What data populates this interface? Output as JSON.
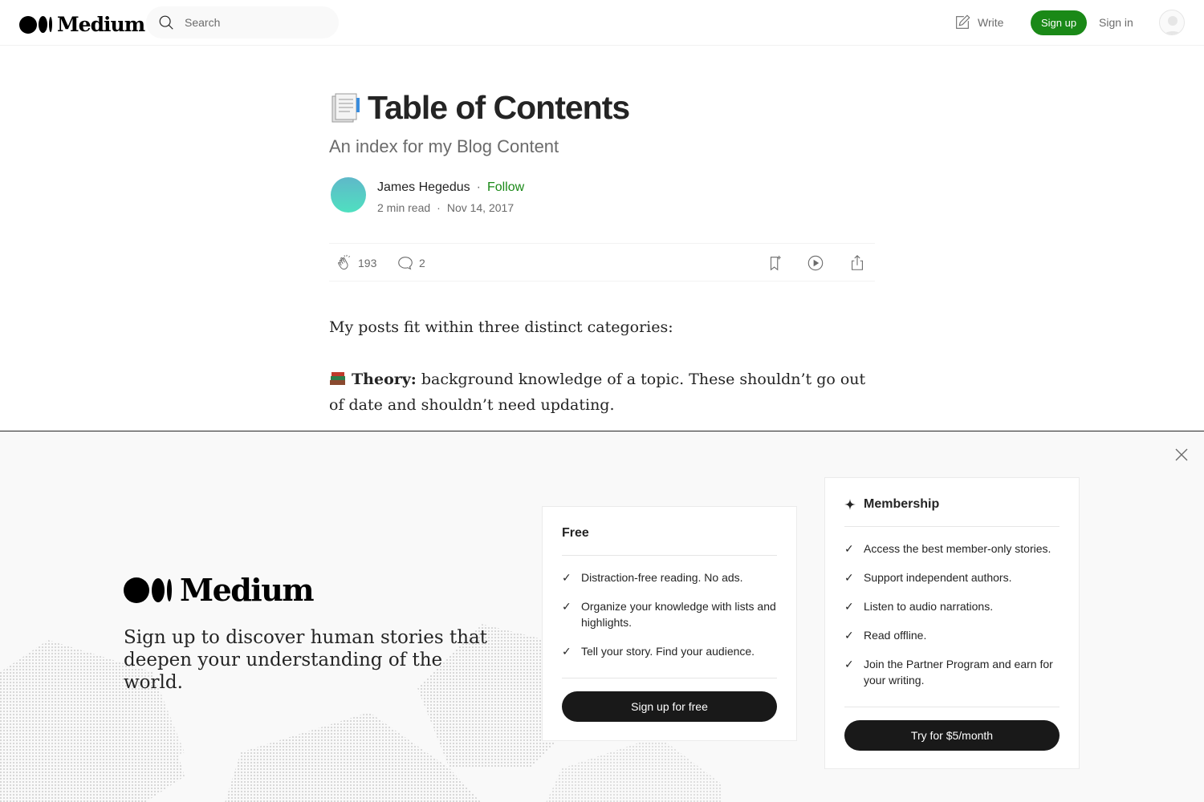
{
  "nav": {
    "logo_text": "Medium",
    "search_placeholder": "Search",
    "write_label": "Write",
    "signup_label": "Sign up",
    "signin_label": "Sign in"
  },
  "article": {
    "title": "Table of Contents",
    "subtitle": "An index for my Blog Content",
    "author": "James Hegedus",
    "author_separator": "·",
    "follow_label": "Follow",
    "read_time": "2 min read",
    "meta_separator": "·",
    "date": "Nov 14, 2017",
    "claps": "193",
    "responses": "2",
    "paragraph_1": "My posts fit within three distinct categories:",
    "theory_label": "Theory:",
    "theory_text": " background knowledge of a topic. These shouldn’t go out of date and shouldn’t need updating."
  },
  "signup_overlay": {
    "logo_text": "Medium",
    "tagline": "Sign up to discover human stories that deepen your understanding of the world.",
    "free": {
      "title": "Free",
      "features": [
        "Distraction-free reading. No ads.",
        "Organize your knowledge with lists and highlights.",
        "Tell your story. Find your audience."
      ],
      "button": "Sign up for free"
    },
    "membership": {
      "title": "Membership",
      "features": [
        "Access the best member-only stories.",
        "Support independent authors.",
        "Listen to audio narrations.",
        "Read offline.",
        "Join the Partner Program and earn for your writing."
      ],
      "button": "Try for $5/month"
    }
  },
  "colors": {
    "accent_green": "#1a8917",
    "text": "#242424",
    "muted": "#6b6b6b",
    "dark_button": "#191919"
  },
  "icons": [
    "search-icon",
    "write-icon",
    "user-icon",
    "clap-icon",
    "comment-icon",
    "bookmark-icon",
    "play-icon",
    "share-icon",
    "close-icon",
    "sparkle-icon",
    "check-icon",
    "books-emoji-icon",
    "document-emoji-icon"
  ]
}
